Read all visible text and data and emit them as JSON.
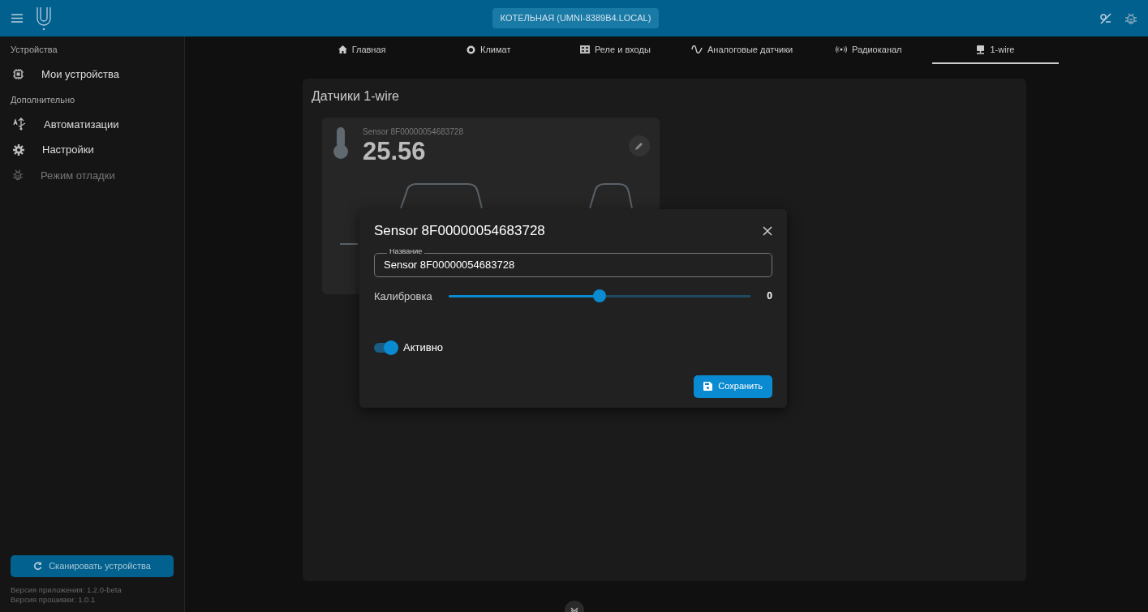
{
  "header": {
    "title": "КОТЕЛЬНАЯ (UMNI-8389B4.LOCAL)"
  },
  "sidebar": {
    "sections": [
      {
        "heading": "Устройства",
        "items": [
          {
            "label": "Мои устройства",
            "disabled": false
          }
        ]
      },
      {
        "heading": "Дополнительно",
        "items": [
          {
            "label": "Автоматизации",
            "disabled": false
          },
          {
            "label": "Настройки",
            "disabled": false
          },
          {
            "label": "Режим отладки",
            "disabled": true
          }
        ]
      }
    ],
    "scan_button": "Сканировать устройства",
    "versions": [
      "Версия приложения: 1.2.0-beta",
      "Версия прошивки: 1.0.1"
    ]
  },
  "tabs": [
    {
      "label": "Главная",
      "selected": false
    },
    {
      "label": "Климат",
      "selected": false
    },
    {
      "label": "Реле и входы",
      "selected": false
    },
    {
      "label": "Аналоговые датчики",
      "selected": false
    },
    {
      "label": "Радиоканал",
      "selected": false
    },
    {
      "label": "1-wire",
      "selected": true
    }
  ],
  "panel": {
    "title": "Датчики 1-wire",
    "sensor": {
      "name": "Sensor 8F00000054683728",
      "value": "25.56"
    }
  },
  "dialog": {
    "title": "Sensor 8F00000054683728",
    "field": {
      "label": "Название",
      "value": "Sensor 8F00000054683728"
    },
    "slider": {
      "label": "Калибровка",
      "level": 0.5,
      "reading": "0"
    },
    "toggle": {
      "label": "Активно",
      "on": true
    },
    "save_button": "Сохранить"
  }
}
